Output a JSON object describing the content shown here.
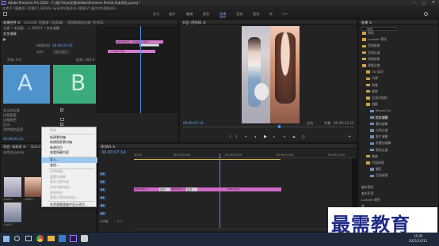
{
  "window": {
    "title": "Adobe Premiere Pro 2020 - C:\\用户\\Acp\\文档\\Adobe\\Premiere Pro\\14.0\\未命名.prproj *"
  },
  "menu": [
    "文件(F)",
    "编辑(E)",
    "剪辑(C)",
    "序列(S)",
    "标记(M)",
    "图形(G)",
    "视图(V)",
    "窗口(W)",
    "帮助(H)"
  ],
  "workspaces": [
    "学习",
    "组件",
    "编辑",
    "颜色",
    "效果",
    "音频",
    "图形",
    "库",
    ">>"
  ],
  "workspace_active": "效果",
  "effect_controls": {
    "tabs": [
      "效果控件 ≡",
      "Lumetri 范围",
      "源: (无剪辑)",
      "音频剪辑混合器: 序列01"
    ],
    "clip_label": "主要 * 未标题... > 序列01 * 交叉溶解",
    "transition_label": "交叉溶解",
    "duration_label": "持续时间",
    "duration_value": "00:00:01:00",
    "alignment_label": "对齐:",
    "alignment_value": "中心切入",
    "start_label": "开始: 0.0",
    "end_label": "结束: 100.0",
    "thumb_a": "A",
    "thumb_b": "B",
    "options": [
      "显示实际源",
      "边框宽度",
      "边框颜色",
      "反向",
      "消除锯齿品质"
    ],
    "options_value": "中",
    "clip_a": "pencarry.....angua.clip...",
    "clip_b": "...mirta.clip",
    "timecode": "00:00:05:01"
  },
  "program_monitor": {
    "tab": "节目: 序列01 ≡",
    "timecode_left": "00:00:07:14",
    "fit_label": "适合",
    "quality_label": "完整",
    "timecode_right": "00:00:12:13",
    "source_bar": "Project A...Rb5 AS7 AS... Project (1)...uncollected"
  },
  "context_menu": {
    "items": [
      {
        "label": "粘贴",
        "state": "disabled"
      },
      {
        "label": "新建素材箱",
        "state": "normal"
      },
      {
        "label": "新建搜索素材箱",
        "state": "normal"
      },
      {
        "label": "新建项目",
        "state": "normal"
      },
      {
        "label": "查看隐藏内容",
        "state": "normal"
      },
      {
        "label": "导入...",
        "state": "highlighted"
      },
      {
        "label": "查找...",
        "state": "normal"
      },
      {
        "label": "对齐网格",
        "state": "disabled"
      },
      {
        "label": "重置为网格",
        "state": "disabled"
      },
      {
        "label": "保存当前布局",
        "state": "disabled"
      },
      {
        "label": "另存为新布局...",
        "state": "disabled"
      },
      {
        "label": "恢复布局",
        "state": "disabled"
      },
      {
        "label": "管理已保存的布局...",
        "state": "disabled"
      },
      {
        "label": "在资源管理器中显示项目...",
        "state": "normal"
      }
    ]
  },
  "project_panel": {
    "tabs": [
      "项目: 未命名 ≡",
      "媒体浏览器",
      "库",
      "信息"
    ],
    "name": "未命名.prproj",
    "clips": [
      "clip01",
      "clip02",
      "clip03"
    ]
  },
  "timeline": {
    "tab": "序列01 ≡",
    "timecode": "00:00:07:14",
    "ruler": [
      "00:00",
      "00:00:05:00",
      "00:00:10:00",
      "00:00:15:00",
      "00:00:20:00"
    ],
    "tracks": [
      "V3",
      "V2",
      "V1",
      "A1",
      "A2",
      "A3"
    ],
    "master_label": "主声道",
    "master_value": "0.0",
    "clip_labels": [
      "pencarry.....",
      "交叉",
      "pencarry....",
      "交叉",
      "pencarry..."
    ]
  },
  "effects_panel": {
    "tab": "效果 ≡",
    "search_placeholder": "搜索",
    "items": [
      {
        "label": "预设",
        "kind": "folder",
        "indent": 0
      },
      {
        "label": "Lumetri 预设",
        "kind": "folder",
        "indent": 0
      },
      {
        "label": "音频效果",
        "kind": "folder",
        "indent": 0
      },
      {
        "label": "音频过渡",
        "kind": "folder",
        "indent": 0
      },
      {
        "label": "视频效果",
        "kind": "folder",
        "indent": 0
      },
      {
        "label": "视频过渡",
        "kind": "folder",
        "indent": 0
      },
      {
        "label": "3D 运动",
        "kind": "folder",
        "indent": 1
      },
      {
        "label": "内滑",
        "kind": "folder",
        "indent": 1
      },
      {
        "label": "划像",
        "kind": "folder",
        "indent": 1
      },
      {
        "label": "擦除",
        "kind": "folder",
        "indent": 1
      },
      {
        "label": "沉浸式视频",
        "kind": "folder",
        "indent": 1
      },
      {
        "label": "溶解",
        "kind": "folder",
        "indent": 1
      },
      {
        "label": "MorphCut",
        "kind": "item",
        "indent": 2
      },
      {
        "label": "交叉溶解",
        "kind": "item",
        "indent": 2
      },
      {
        "label": "叠加溶解",
        "kind": "item",
        "indent": 2
      },
      {
        "label": "白场过渡",
        "kind": "item",
        "indent": 2
      },
      {
        "label": "胶片溶解",
        "kind": "item",
        "indent": 2
      },
      {
        "label": "非叠加溶解",
        "kind": "item",
        "indent": 2
      },
      {
        "label": "黑场过渡",
        "kind": "item",
        "indent": 2
      },
      {
        "label": "缩放",
        "kind": "folder",
        "indent": 1
      },
      {
        "label": "页面剥落",
        "kind": "folder",
        "indent": 1
      },
      {
        "label": "翻页",
        "kind": "item",
        "indent": 2
      },
      {
        "label": "页面剥落",
        "kind": "item",
        "indent": 2
      }
    ],
    "bottom": [
      "基本图形",
      "基本声音",
      "Lumetri 颜色",
      "库",
      "标记",
      "历史记录"
    ]
  },
  "watermark": "最需教育",
  "taskbar": {
    "clock_time": "15:05",
    "clock_date": "2021/10/15"
  }
}
